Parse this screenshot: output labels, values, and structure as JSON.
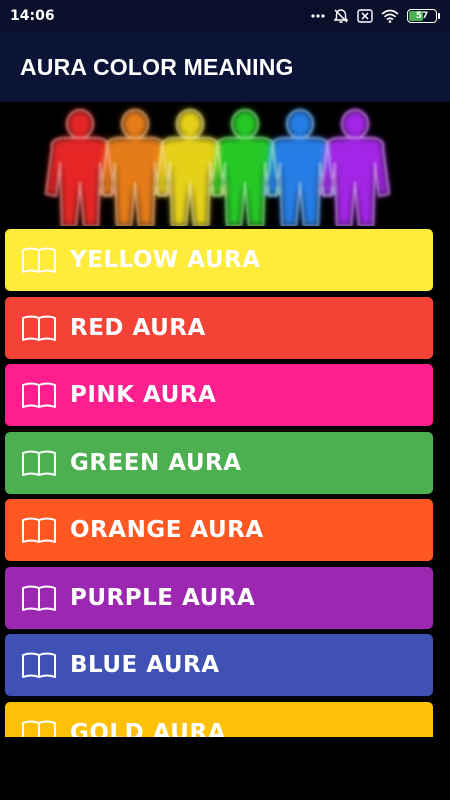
{
  "status_bar": {
    "time": "14:06",
    "battery_level": "57",
    "icons": [
      "more-dots-icon",
      "alarm-off-icon",
      "sim-x-icon",
      "wifi-icon",
      "battery-icon"
    ]
  },
  "app_bar": {
    "title": "AURA COLOR MEANING"
  },
  "banner": {
    "icon": "aura-silhouettes-image"
  },
  "list": {
    "items": [
      {
        "label": "YELLOW AURA",
        "color": "#ffeb3b"
      },
      {
        "label": "RED AURA",
        "color": "#f44336"
      },
      {
        "label": "PINK AURA",
        "color": "#ff1e8e"
      },
      {
        "label": "GREEN AURA",
        "color": "#4caf50"
      },
      {
        "label": "ORANGE AURA",
        "color": "#ff5722"
      },
      {
        "label": "PURPLE AURA",
        "color": "#9c27b0"
      },
      {
        "label": "BLUE AURA",
        "color": "#3f51b5"
      },
      {
        "label": "GOLD AURA",
        "color": "#ffc107"
      }
    ]
  }
}
